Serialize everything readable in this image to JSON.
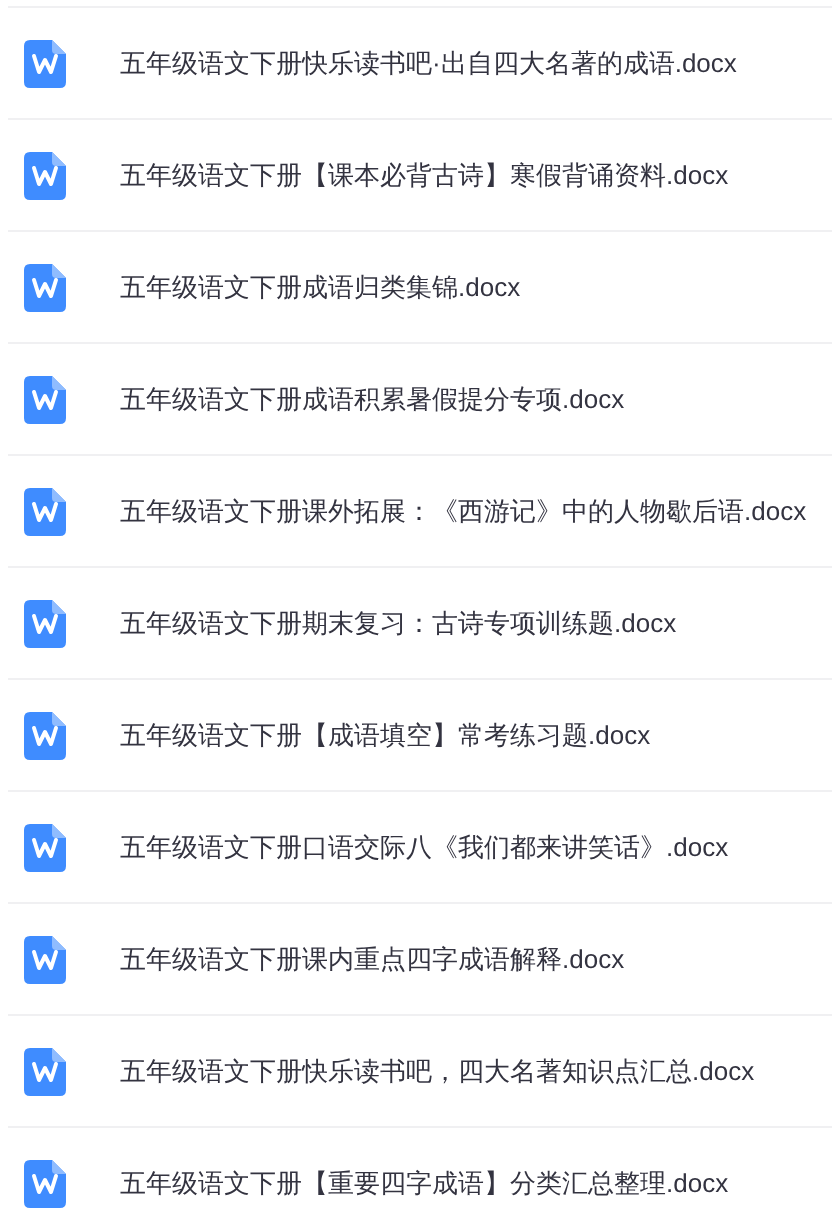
{
  "files": [
    {
      "name": "五年级语文下册快乐读书吧·出自四大名著的成语.docx",
      "kind": "word"
    },
    {
      "name": "五年级语文下册【课本必背古诗】寒假背诵资料.docx",
      "kind": "word"
    },
    {
      "name": "五年级语文下册成语归类集锦.docx",
      "kind": "word"
    },
    {
      "name": "五年级语文下册成语积累暑假提分专项.docx",
      "kind": "word"
    },
    {
      "name": "五年级语文下册课外拓展：《西游记》中的人物歇后语.docx",
      "kind": "word"
    },
    {
      "name": "五年级语文下册期末复习：古诗专项训练题.docx",
      "kind": "word"
    },
    {
      "name": "五年级语文下册【成语填空】常考练习题.docx",
      "kind": "word"
    },
    {
      "name": "五年级语文下册口语交际八《我们都来讲笑话》.docx",
      "kind": "word"
    },
    {
      "name": "五年级语文下册课内重点四字成语解释.docx",
      "kind": "word"
    },
    {
      "name": "五年级语文下册快乐读书吧，四大名著知识点汇总.docx",
      "kind": "word"
    },
    {
      "name": "五年级语文下册【重要四字成语】分类汇总整理.docx",
      "kind": "word"
    }
  ]
}
